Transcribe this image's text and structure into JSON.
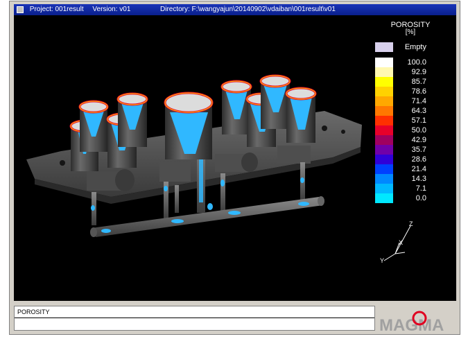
{
  "titlebar": {
    "project": "Project: 001result",
    "version": "Version: v01",
    "directory": "Directory: F:\\wangyajun\\20140902\\vdaiban\\001result\\v01"
  },
  "legend": {
    "title": "POROSITY",
    "unit": "[%]",
    "entries": [
      {
        "label": "Empty",
        "color": "#d8d0ec"
      },
      {
        "label": "100.0",
        "color": "#ffffff"
      },
      {
        "label": "92.9",
        "color": "#fff8b0"
      },
      {
        "label": "85.7",
        "color": "#ffff00"
      },
      {
        "label": "78.6",
        "color": "#ffd200"
      },
      {
        "label": "71.4",
        "color": "#ffa800"
      },
      {
        "label": "64.3",
        "color": "#ff7800"
      },
      {
        "label": "57.1",
        "color": "#ff3000"
      },
      {
        "label": "50.0",
        "color": "#e8002a"
      },
      {
        "label": "42.9",
        "color": "#a00060"
      },
      {
        "label": "35.7",
        "color": "#7000a8"
      },
      {
        "label": "28.6",
        "color": "#3000d8"
      },
      {
        "label": "21.4",
        "color": "#0040ff"
      },
      {
        "label": "14.3",
        "color": "#0088ff"
      },
      {
        "label": "7.1",
        "color": "#00b8ff"
      },
      {
        "label": "0.0",
        "color": "#00e8ff"
      }
    ]
  },
  "axes": {
    "z": "Z",
    "x": "X",
    "y": "Y"
  },
  "status": {
    "result_name": "POROSITY"
  },
  "logo": {
    "text": "MAGMA"
  }
}
